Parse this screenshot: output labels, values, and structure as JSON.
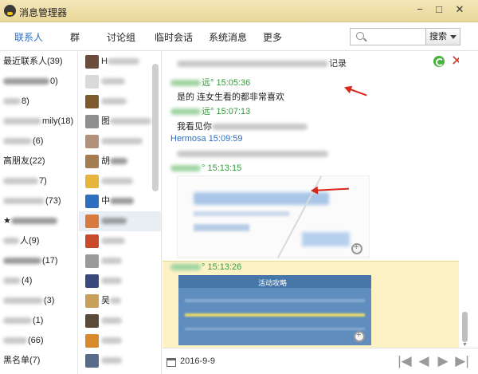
{
  "window": {
    "title": "消息管理器",
    "minimize": "−",
    "maximize": "□",
    "close": "✕"
  },
  "nav": {
    "tabs": [
      "联系人",
      "群",
      "讨论组",
      "临时会话",
      "系统消息",
      "更多"
    ],
    "active_tab": "联系人",
    "search_placeholder": "",
    "search_button": "搜索"
  },
  "groups": [
    {
      "label": "最近联系人(39)"
    },
    {
      "label": "0)"
    },
    {
      "label": "8)"
    },
    {
      "label": "mily(18)"
    },
    {
      "label": "(6)"
    },
    {
      "label": "高朋友(22)"
    },
    {
      "label": "7)"
    },
    {
      "label": "(73)"
    },
    {
      "label": "★"
    },
    {
      "label": "人(9)"
    },
    {
      "label": "(17)"
    },
    {
      "label": "(4)"
    },
    {
      "label": "(3)"
    },
    {
      "label": "(1)"
    },
    {
      "label": "(66)"
    },
    {
      "label": "黑名单(7)"
    }
  ],
  "contacts": [
    {
      "name": "H",
      "color": "#6b4b3a"
    },
    {
      "name": "",
      "color": "#d9d9d9"
    },
    {
      "name": "",
      "color": "#7d5a2f"
    },
    {
      "name": "图",
      "color": "#8f8f8f"
    },
    {
      "name": "",
      "color": "#b3907a"
    },
    {
      "name": "胡",
      "color": "#a67c52"
    },
    {
      "name": "",
      "color": "#e8b53c"
    },
    {
      "name": "中",
      "color": "#2f6fbf"
    },
    {
      "name": "",
      "color": "#d87a3d"
    },
    {
      "name": "",
      "color": "#c94a2a"
    },
    {
      "name": "",
      "color": "#9a9a9a"
    },
    {
      "name": "",
      "color": "#3a4a7a"
    },
    {
      "name": "吴",
      "color": "#c9a05a"
    },
    {
      "name": "",
      "color": "#5a4a3a"
    },
    {
      "name": "",
      "color": "#d88a2a"
    },
    {
      "name": "",
      "color": "#5a6a8a"
    }
  ],
  "messages": {
    "header_suffix": "记录",
    "items": [
      {
        "sender_tail": "远°",
        "time": "15:05:36",
        "text": "是的 连女生看的都非常喜欢"
      },
      {
        "sender_tail": "远°",
        "time": "15:07:13",
        "text": "我看见你"
      },
      {
        "sender": "Hermosa",
        "time": "15:09:59",
        "text": ""
      },
      {
        "sender_tail": "°",
        "time": "15:13:15"
      },
      {
        "sender_tail": "°",
        "time": "15:13:26"
      }
    ],
    "image2_title": "活动攻略"
  },
  "bottom": {
    "date": "2016-9-9",
    "first": "|◀",
    "prev": "◀",
    "next": "▶",
    "last": "▶|"
  },
  "colors": {
    "accent_blue": "#2a6fc9",
    "time_green": "#2f9c3a",
    "highlight": "#fdf2c6",
    "arrow_red": "#d8281c"
  }
}
